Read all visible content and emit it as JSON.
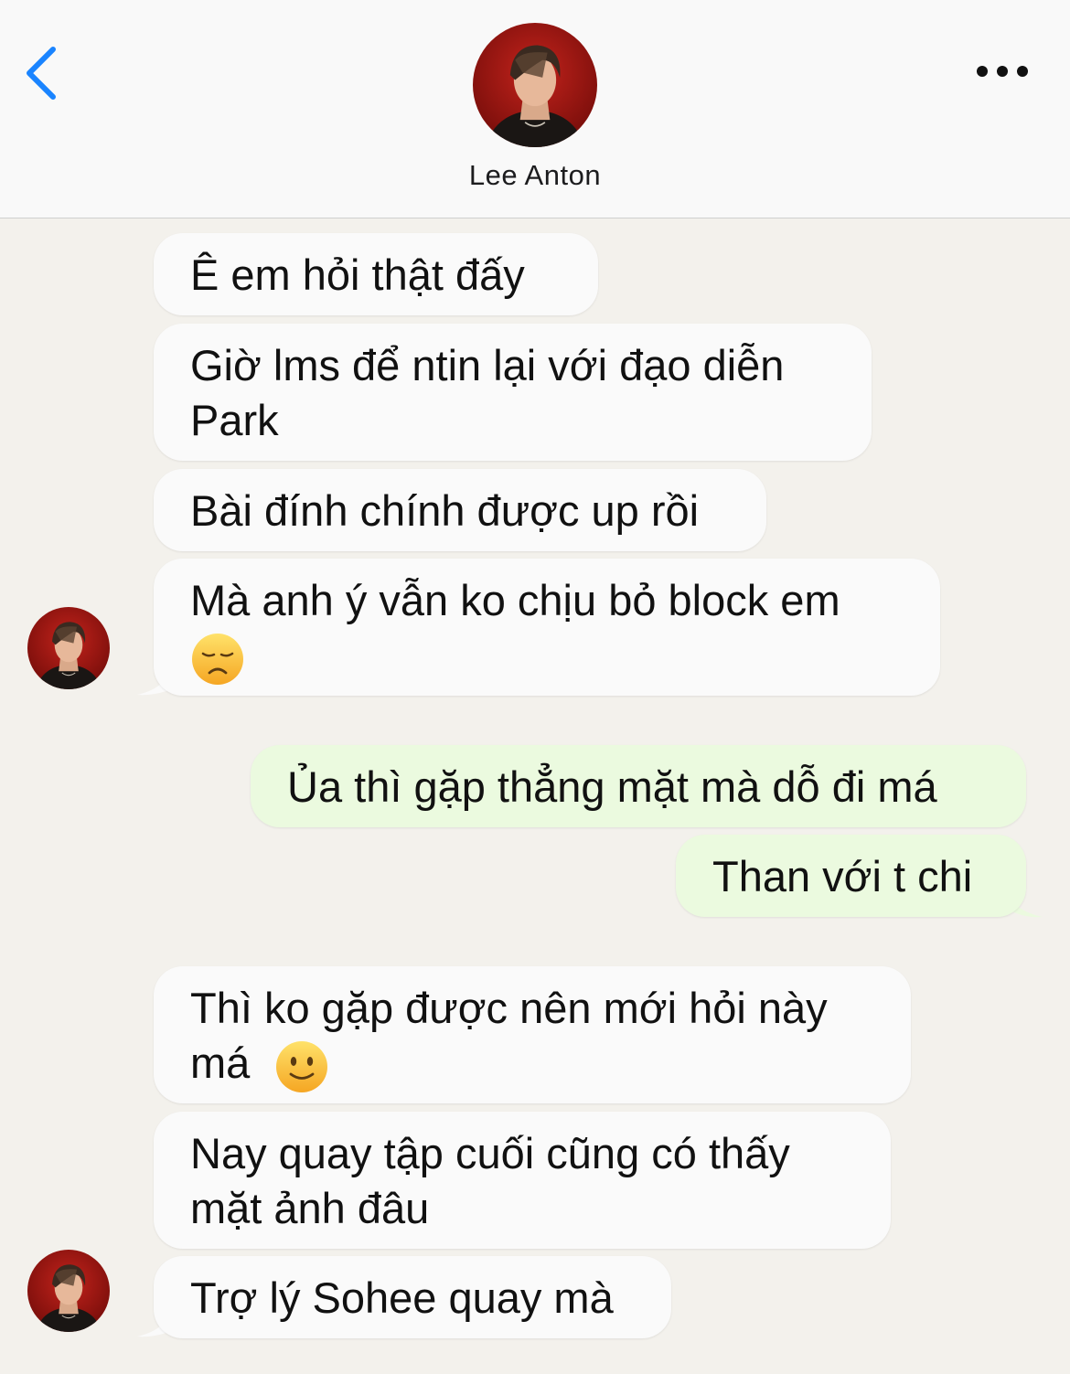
{
  "header": {
    "contact_name": "Lee Anton",
    "back_icon": "chevron-left-icon",
    "more_icon": "ellipsis-icon",
    "accent_color": "#1a84ff"
  },
  "colors": {
    "incoming_bubble": "#fafafa",
    "outgoing_bubble": "#ebfadf",
    "background": "#f3f1ec"
  },
  "messages": [
    {
      "direction": "incoming",
      "text": "Ê em hỏi thật đấy"
    },
    {
      "direction": "incoming",
      "text_l1": "Giờ lms để ntin lại với đạo diễn",
      "text_l2": "Park"
    },
    {
      "direction": "incoming",
      "text": "Bài đính chính được up rồi"
    },
    {
      "direction": "incoming",
      "text_l1": "Mà anh ý vẫn ko chịu bỏ block em",
      "emoji": "disappointed-face-emoji"
    },
    {
      "direction": "outgoing",
      "text": "Ủa thì gặp thẳng mặt mà dỗ đi má"
    },
    {
      "direction": "outgoing",
      "text": "Than với t chi"
    },
    {
      "direction": "incoming",
      "text_l1": "Thì ko gặp được nên mới hỏi này",
      "text_l2": "má",
      "emoji": "slightly-smiling-face-emoji"
    },
    {
      "direction": "incoming",
      "text_l1": "Nay quay tập cuối cũng có thấy",
      "text_l2": "mặt ảnh đâu"
    },
    {
      "direction": "incoming",
      "text": "Trợ lý Sohee quay mà"
    }
  ]
}
